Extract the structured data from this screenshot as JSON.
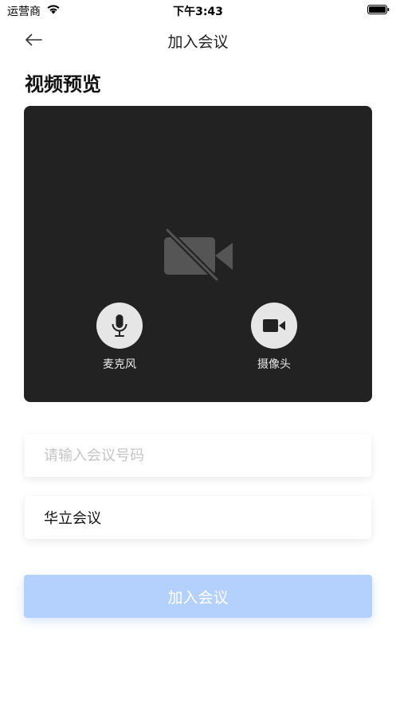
{
  "status_bar": {
    "carrier": "运营商",
    "time": "下午3:43"
  },
  "nav": {
    "title": "加入会议",
    "back_icon": "arrow-left-icon"
  },
  "preview": {
    "section_title": "视频预览",
    "camera_off_icon": "video-off-icon",
    "controls": {
      "microphone": {
        "label": "麦克风",
        "icon": "microphone-icon"
      },
      "camera": {
        "label": "摄像头",
        "icon": "video-camera-icon"
      }
    }
  },
  "form": {
    "meeting_number": {
      "value": "",
      "placeholder": "请输入会议号码"
    },
    "display_name": {
      "value": "华立会议",
      "placeholder": ""
    }
  },
  "join_button": {
    "label": "加入会议",
    "state": "disabled"
  },
  "colors": {
    "preview_background": "#222222",
    "control_circle": "#e6e6e6",
    "join_button_disabled": "#b3d1fc",
    "placeholder_text": "#c4c4c4"
  }
}
